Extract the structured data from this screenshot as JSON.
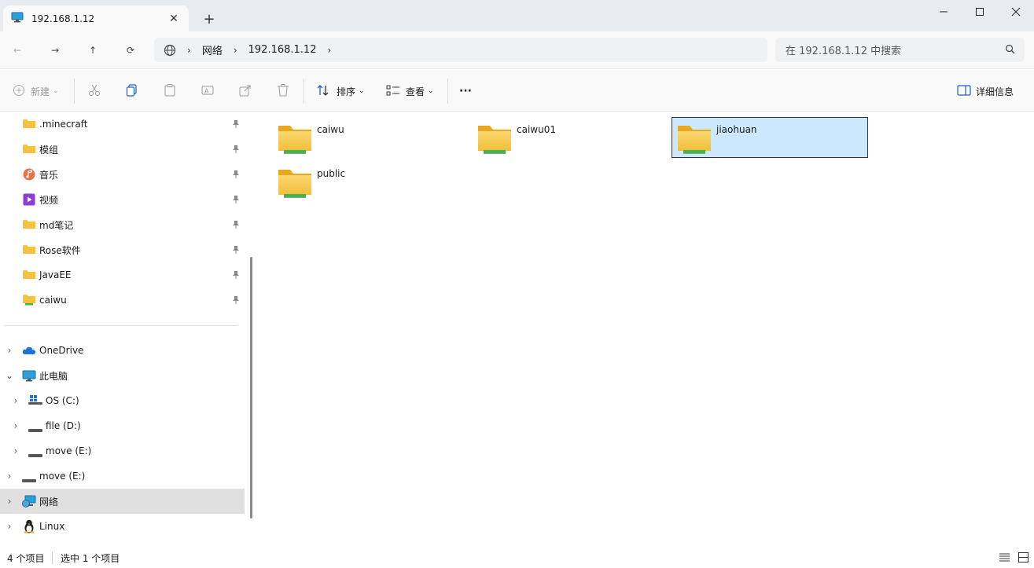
{
  "titlebar": {
    "tab_title": "192.168.1.12",
    "new_tab": "+",
    "minimize": "—",
    "maximize": "☐",
    "close": "✕"
  },
  "nav": {
    "back": "←",
    "forward": "→",
    "up": "↑",
    "refresh": "⟳",
    "breadcrumb": [
      "网络",
      "192.168.1.12"
    ],
    "search_placeholder": "在 192.168.1.12 中搜索"
  },
  "toolbar": {
    "new_label": "新建",
    "sort_label": "排序",
    "view_label": "查看",
    "more_label": "···",
    "details_label": "详细信息"
  },
  "sidebar": {
    "quick_access": [
      {
        "label": ".minecraft",
        "icon": "folder-icon"
      },
      {
        "label": "模组",
        "icon": "folder-icon"
      },
      {
        "label": "音乐",
        "icon": "music-icon"
      },
      {
        "label": "视频",
        "icon": "video-icon"
      },
      {
        "label": "md笔记",
        "icon": "folder-icon"
      },
      {
        "label": "Rose软件",
        "icon": "folder-icon"
      },
      {
        "label": "JavaEE",
        "icon": "folder-icon"
      },
      {
        "label": "caiwu",
        "icon": "network-folder-icon"
      }
    ],
    "tree": [
      {
        "label": "OneDrive",
        "icon": "cloud-icon"
      },
      {
        "label": "此电脑",
        "icon": "computer-icon"
      },
      {
        "label": "OS (C:)",
        "icon": "windows-drive-icon"
      },
      {
        "label": "file (D:)",
        "icon": "drive-icon"
      },
      {
        "label": "move (E:)",
        "icon": "drive-icon"
      },
      {
        "label": "move (E:)",
        "icon": "drive-icon"
      },
      {
        "label": "网络",
        "icon": "network-icon"
      },
      {
        "label": "Linux",
        "icon": "linux-icon"
      }
    ]
  },
  "content": {
    "folders": [
      {
        "name": "caiwu"
      },
      {
        "name": "caiwu01"
      },
      {
        "name": "jiaohuan"
      },
      {
        "name": "public"
      }
    ]
  },
  "status": {
    "count": "4 个项目",
    "selected": "选中 1 个项目"
  },
  "colors": {
    "selection": "#cce8ff",
    "folder": "#f5c43c",
    "share_green": "#3cb94a"
  }
}
